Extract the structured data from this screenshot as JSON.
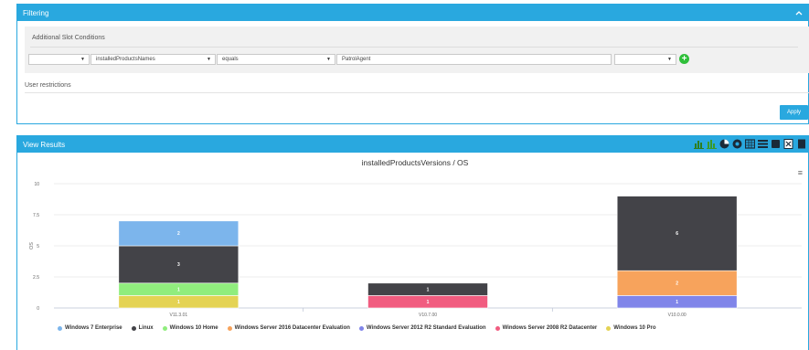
{
  "filtering": {
    "title": "Filtering",
    "section_title": "Additional Slot Conditions",
    "cond_op_value": "",
    "field_value": "installedProductsNames",
    "operator_value": "equals",
    "match_value": "PatrolAgent",
    "extra_value": "",
    "user_restrictions_label": "User restrictions",
    "apply_label": "Apply"
  },
  "results": {
    "title": "View Results",
    "toolbar_icons": [
      "bar-chart-icon",
      "stacked-bar-icon",
      "pie-icon",
      "donut-icon",
      "table-icon",
      "list-icon",
      "square-icon",
      "export-icon",
      "more-icon"
    ]
  },
  "chart_data": {
    "type": "bar",
    "stacked": true,
    "title": "installedProductsVersions / OS",
    "xlabel": "",
    "ylabel": "OS",
    "ylim": [
      0,
      10
    ],
    "yticks": [
      "0",
      "2.5",
      "5",
      "7.5",
      "10"
    ],
    "categories": [
      "V11.3.01",
      "V10.7.00",
      "V10.0.00"
    ],
    "series": [
      {
        "name": "Windows 10 Pro",
        "color": "#e4d354",
        "values": [
          1,
          0,
          0
        ]
      },
      {
        "name": "Windows 2008 R2 Datacenter",
        "color": "#f15c80",
        "values": [
          0,
          1,
          0
        ]
      },
      {
        "name": "Windows Server 2012 R2 Standard Evaluation",
        "color": "#8085e9",
        "values": [
          0,
          0,
          1
        ]
      },
      {
        "name": "Windows 10 Home",
        "color": "#90ed7d",
        "values": [
          1,
          0,
          0
        ]
      },
      {
        "name": "Windows Server 2016 Datacenter Evaluation",
        "color": "#f7a35c",
        "values": [
          0,
          0,
          2
        ]
      },
      {
        "name": "Linux",
        "color": "#434348",
        "values": [
          3,
          1,
          6
        ]
      },
      {
        "name": "Windows 7 Enterprise",
        "color": "#7cb5ec",
        "values": [
          2,
          0,
          0
        ]
      }
    ],
    "legend": [
      "Windows 7 Enterprise",
      "Linux",
      "Windows 10 Home",
      "Windows Server 2016 Datacenter Evaluation",
      "Windows Server 2012 R2 Standard Evaluation",
      "Windows Server 2008 R2 Datacenter",
      "Windows 10 Pro"
    ],
    "legend_colors": [
      "#7cb5ec",
      "#434348",
      "#90ed7d",
      "#f7a35c",
      "#8085e9",
      "#f15c80",
      "#e4d354"
    ],
    "legend_position": "bottom"
  }
}
